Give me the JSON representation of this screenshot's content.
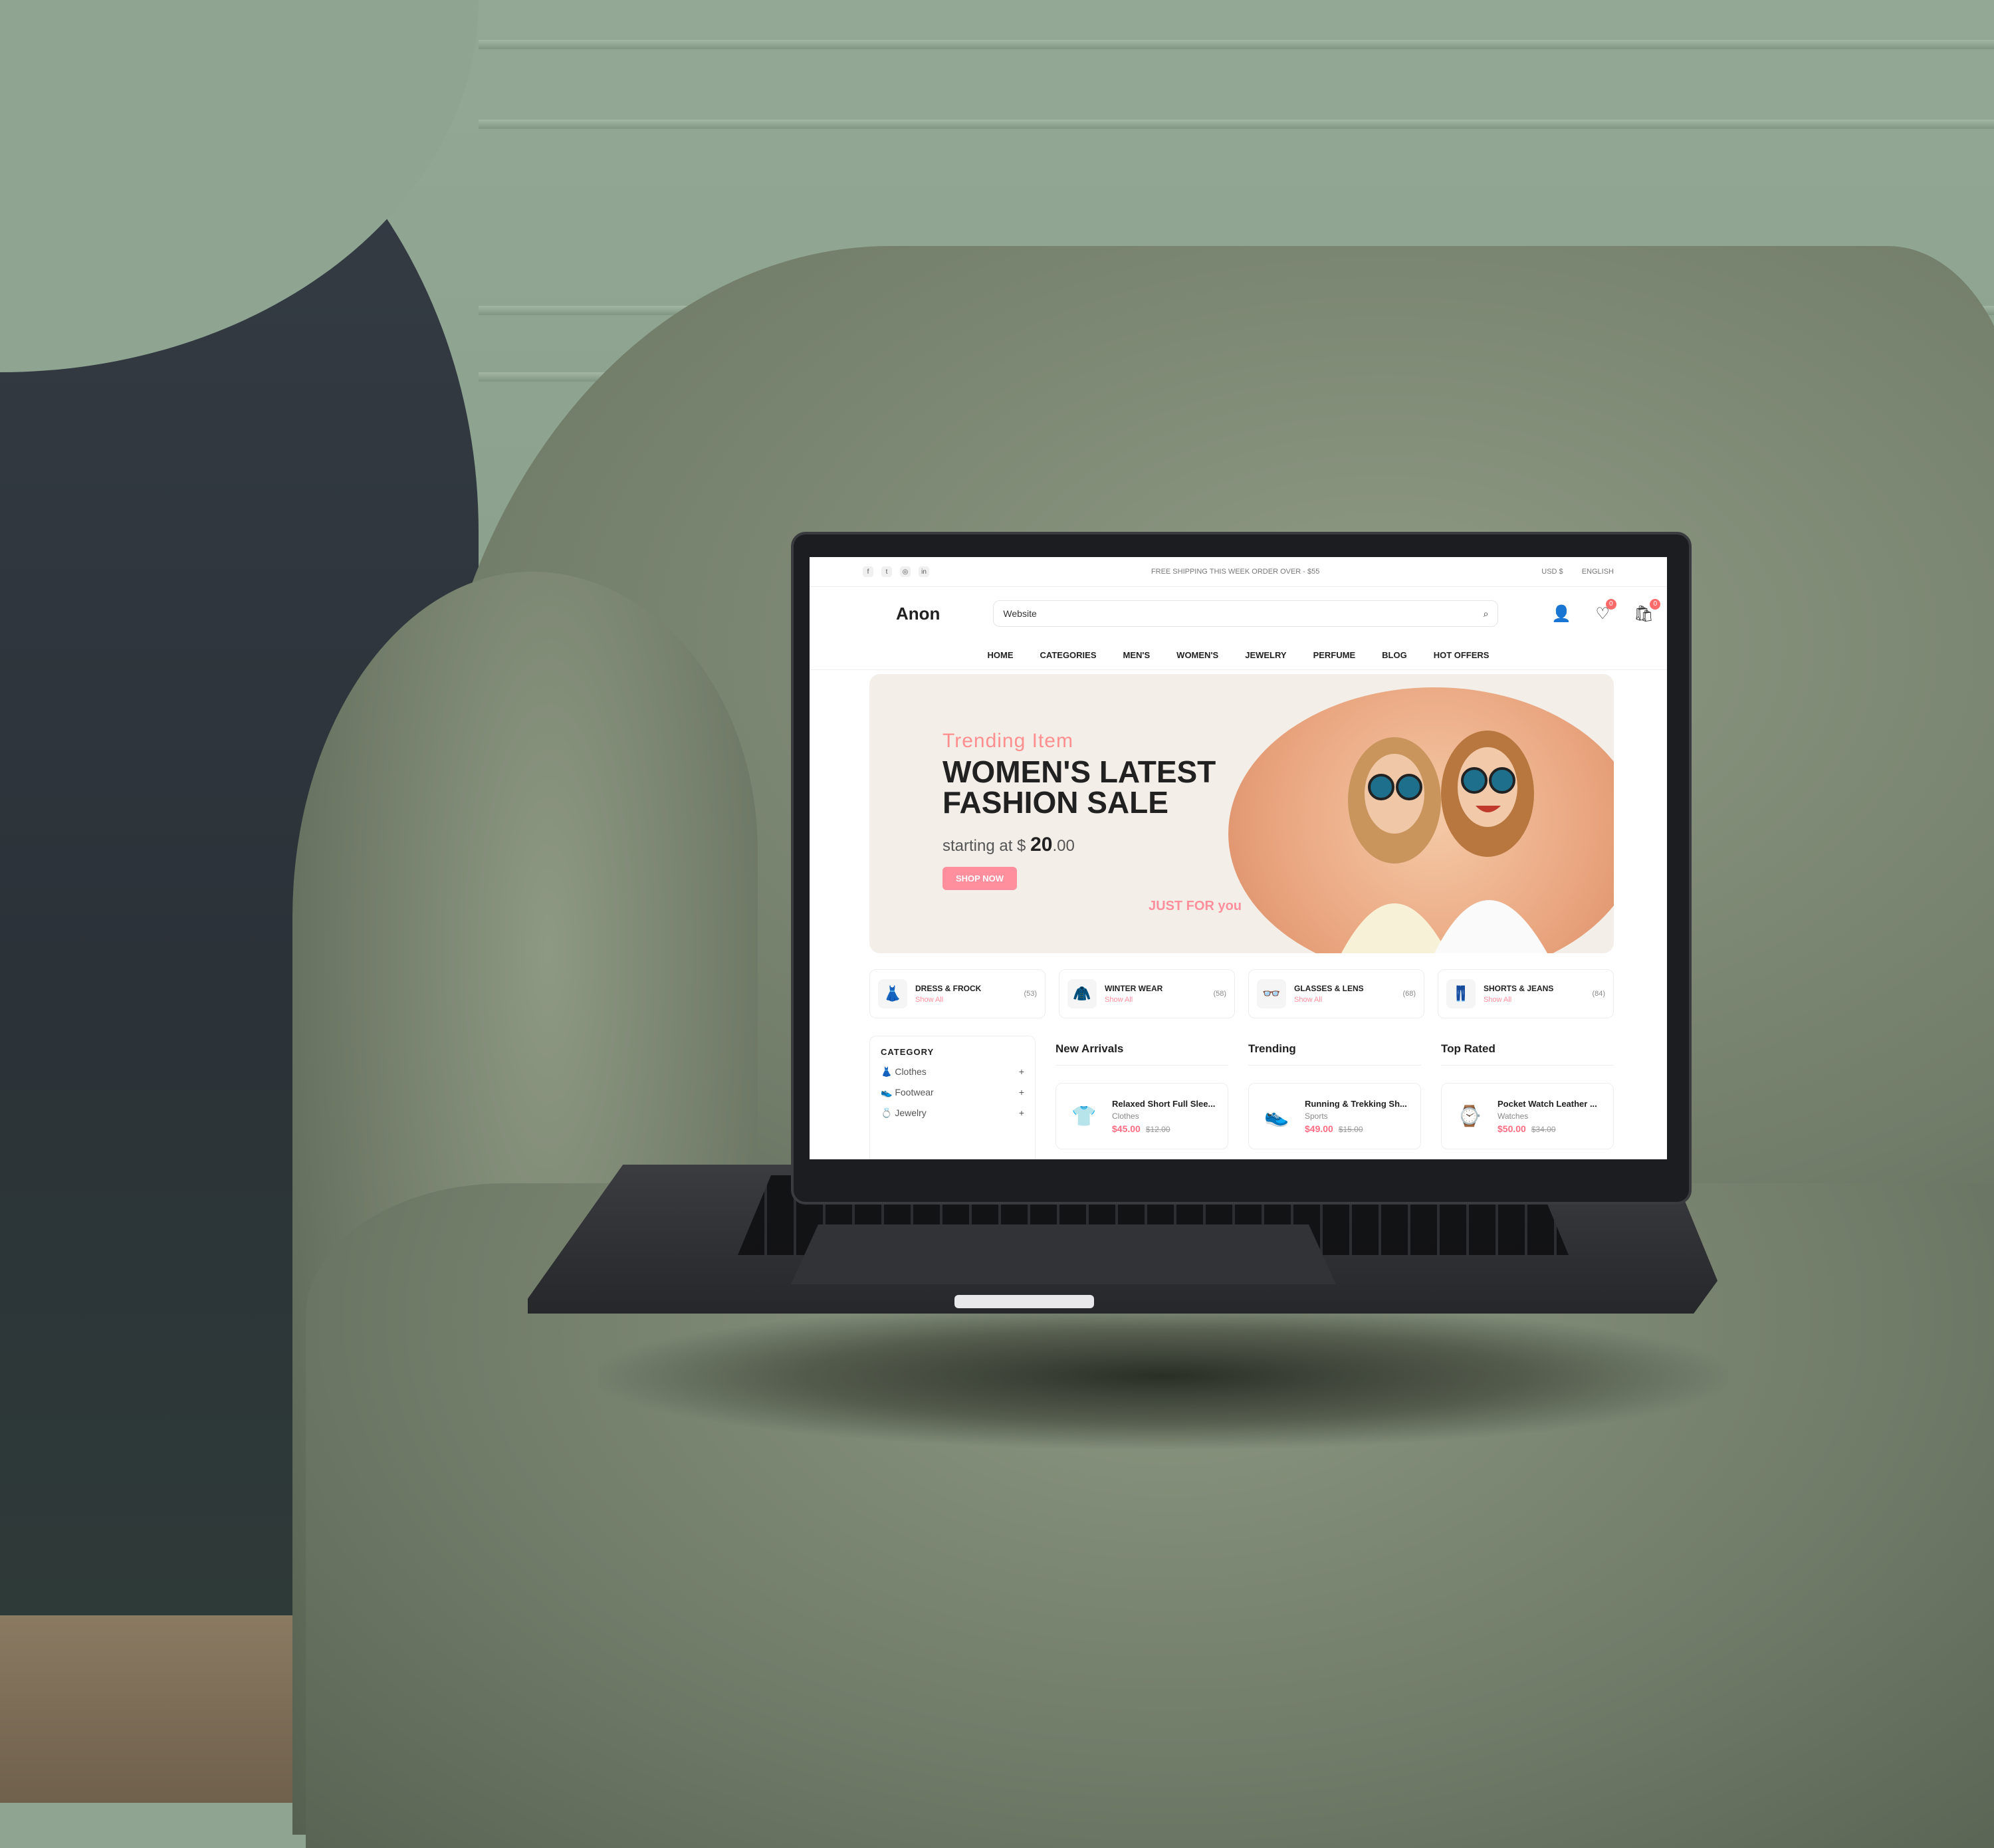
{
  "topbar": {
    "socials": [
      {
        "icon": "facebook-icon",
        "glyph": "f"
      },
      {
        "icon": "twitter-icon",
        "glyph": "t"
      },
      {
        "icon": "instagram-icon",
        "glyph": "◎"
      },
      {
        "icon": "linkedin-icon",
        "glyph": "in"
      }
    ],
    "shipping": "FREE SHIPPING THIS WEEK ORDER OVER - $55",
    "currency": "USD $",
    "language": "ENGLISH"
  },
  "header": {
    "logo": "Anon",
    "search_value": "Website",
    "wishlist_count": "0",
    "cart_count": "0"
  },
  "nav": [
    "HOME",
    "CATEGORIES",
    "MEN'S",
    "WOMEN'S",
    "JEWELRY",
    "PERFUME",
    "BLOG",
    "HOT OFFERS"
  ],
  "banner": {
    "subtitle": "Trending Item",
    "title": "WOMEN'S LATEST FASHION SALE",
    "price_prefix": "starting at $ ",
    "price_main": "20",
    "price_cents": ".00",
    "button": "SHOP NOW",
    "stamp": "JUST FOR you"
  },
  "categories": [
    {
      "name": "DRESS & FROCK",
      "count": "(53)",
      "link": "Show All",
      "icon": "dress-icon",
      "glyph": "👗"
    },
    {
      "name": "WINTER WEAR",
      "count": "(58)",
      "link": "Show All",
      "icon": "coat-icon",
      "glyph": "🧥"
    },
    {
      "name": "GLASSES & LENS",
      "count": "(68)",
      "link": "Show All",
      "icon": "glasses-icon",
      "glyph": "👓"
    },
    {
      "name": "SHORTS & JEANS",
      "count": "(84)",
      "link": "Show All",
      "icon": "jeans-icon",
      "glyph": "👖"
    }
  ],
  "sidebar": {
    "title": "CATEGORY",
    "items": [
      {
        "label": "Clothes",
        "icon": "clothes-icon",
        "glyph": "👗"
      },
      {
        "label": "Footwear",
        "icon": "shoe-icon",
        "glyph": "👟"
      },
      {
        "label": "Jewelry",
        "icon": "jewelry-icon",
        "glyph": "💍"
      }
    ]
  },
  "columns": [
    {
      "title": "New Arrivals",
      "product": {
        "name": "Relaxed Short Full Slee...",
        "category": "Clothes",
        "price": "$45.00",
        "old": "$12.00",
        "icon": "shirt-icon",
        "glyph": "👕"
      }
    },
    {
      "title": "Trending",
      "product": {
        "name": "Running & Trekking Sh...",
        "category": "Sports",
        "price": "$49.00",
        "old": "$15.00",
        "icon": "sneaker-icon",
        "glyph": "👟"
      }
    },
    {
      "title": "Top Rated",
      "product": {
        "name": "Pocket Watch Leather ...",
        "category": "Watches",
        "price": "$50.00",
        "old": "$34.00",
        "icon": "watch-icon",
        "glyph": "⌚"
      }
    }
  ],
  "colors": {
    "accent": "#ff8f9c",
    "price": "#ff6b81",
    "text": "#212121"
  }
}
